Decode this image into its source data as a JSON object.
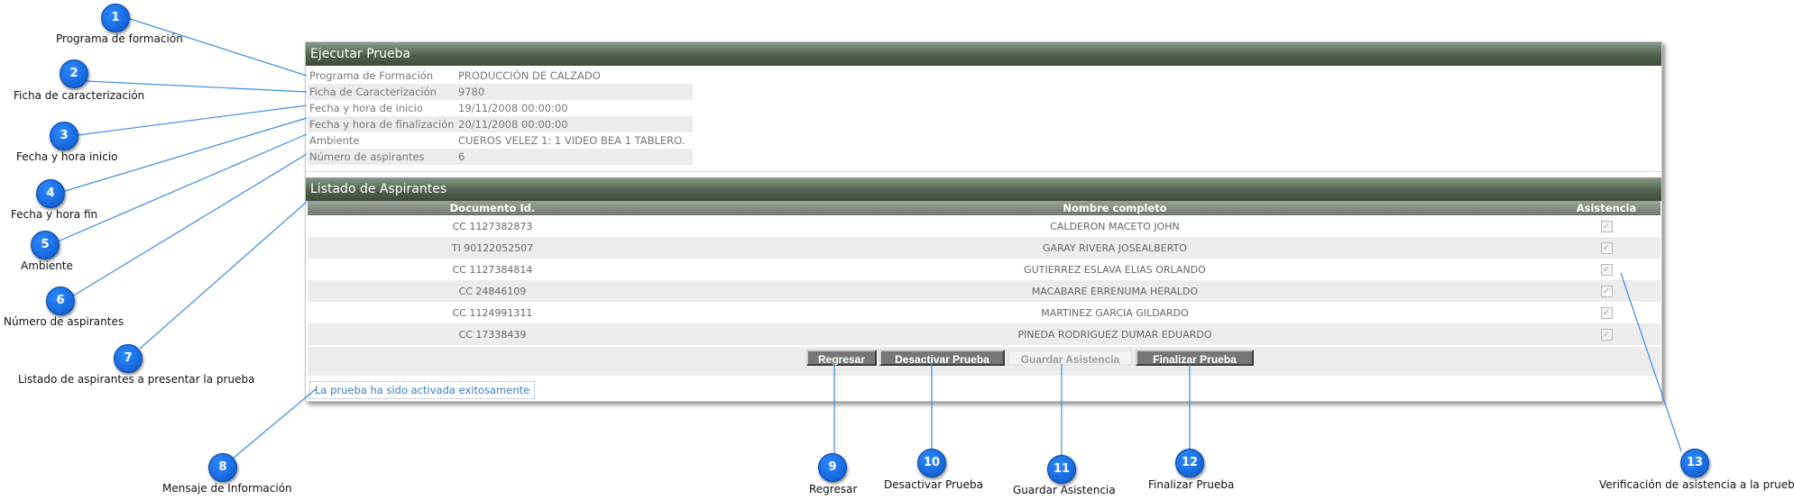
{
  "panel": {
    "header1": "Ejecutar Prueba",
    "info_rows": [
      {
        "label": "Programa de Formación",
        "value": "PRODUCCIÓN DE CALZADO"
      },
      {
        "label": "Ficha de Caracterización",
        "value": "9780"
      },
      {
        "label": "Fecha y hora de inicio",
        "value": "19/11/2008 00:00:00"
      },
      {
        "label": "Fecha y hora de finalización",
        "value": "20/11/2008 00:00:00"
      },
      {
        "label": "Ambiente",
        "value": "CUEROS VELEZ 1: 1 VIDEO BEA 1 TABLERO."
      },
      {
        "label": "Número de aspirantes",
        "value": "6"
      }
    ],
    "header2": "Listado de Aspirantes",
    "table": {
      "columns": [
        "Documento Id.",
        "Nombre completo",
        "Asistencia"
      ],
      "rows": [
        {
          "doc": "CC 1127382873",
          "name": "CALDERON MACETO JOHN",
          "checked": true
        },
        {
          "doc": "TI 90122052507",
          "name": "GARAY RIVERA JOSEALBERTO",
          "checked": true
        },
        {
          "doc": "CC 1127384814",
          "name": "GUTIERREZ ESLAVA ELIAS ORLANDO",
          "checked": true
        },
        {
          "doc": "CC 24846109",
          "name": "MACABARE ERRENUMA HERALDO",
          "checked": true
        },
        {
          "doc": "CC 1124991311",
          "name": "MARTINEZ GARCIA GILDARDO",
          "checked": true
        },
        {
          "doc": "CC 17338439",
          "name": "PINEDA RODRIGUEZ DUMAR EDUARDO",
          "checked": true
        }
      ]
    },
    "buttons": {
      "regresar": "Regresar",
      "desactivar": "Desactivar Prueba",
      "guardar": "Guardar Asistencia",
      "finalizar": "Finalizar Prueba"
    },
    "message": "La prueba ha sido activada exitosamente"
  },
  "callouts": [
    {
      "n": "1",
      "label": "Programa de formación"
    },
    {
      "n": "2",
      "label": "Ficha de caracterización"
    },
    {
      "n": "3",
      "label": "Fecha y hora inicio"
    },
    {
      "n": "4",
      "label": "Fecha y hora fin"
    },
    {
      "n": "5",
      "label": "Ambiente"
    },
    {
      "n": "6",
      "label": "Número de aspirantes"
    },
    {
      "n": "7",
      "label": "Listado de aspirantes a presentar la prueba"
    },
    {
      "n": "8",
      "label": "Mensaje de Información"
    },
    {
      "n": "9",
      "label": "Regresar"
    },
    {
      "n": "10",
      "label": "Desactivar Prueba"
    },
    {
      "n": "11",
      "label": "Guardar Asistencia"
    },
    {
      "n": "12",
      "label": "Finalizar Prueba"
    },
    {
      "n": "13",
      "label": "Verificación de asistencia a la prueba"
    }
  ],
  "colors": {
    "callout": "#1a6fe8",
    "leader_line": "#3d8be0",
    "header": "#52604f"
  }
}
